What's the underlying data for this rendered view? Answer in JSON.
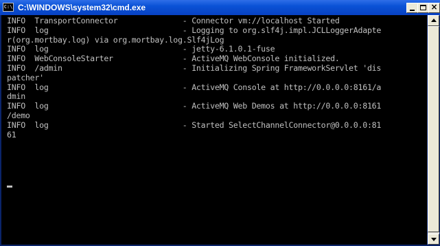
{
  "window": {
    "title": "C:\\WINDOWS\\system32\\cmd.exe",
    "icon_label": "C:\\",
    "close_glyph": "×"
  },
  "console": {
    "text": "INFO  TransportConnector              - Connector vm://localhost Started\nINFO  log                             - Logging to org.slf4j.impl.JCLLoggerAdapte\nr(org.mortbay.log) via org.mortbay.log.Slf4jLog\nINFO  log                             - jetty-6.1.0.1-fuse\nINFO  WebConsoleStarter               - ActiveMQ WebConsole initialized.\nINFO  /admin                          - Initializing Spring FrameworkServlet 'dis\npatcher'\nINFO  log                             - ActiveMQ Console at http://0.0.0.0:8161/a\ndmin\nINFO  log                             - ActiveMQ Web Demos at http://0.0.0.0:8161\n/demo\nINFO  log                             - Started SelectChannelConnector@0.0.0.0:81\n61"
  },
  "colors": {
    "title_bar": "#0a52d6",
    "console_background": "#000000",
    "console_text": "#c0c0c0"
  },
  "icons": {
    "system": "cmd-icon",
    "minimize": "minimize-icon",
    "maximize": "maximize-icon",
    "close": "close-icon",
    "scroll_up": "arrow-up-icon",
    "scroll_down": "arrow-down-icon"
  }
}
